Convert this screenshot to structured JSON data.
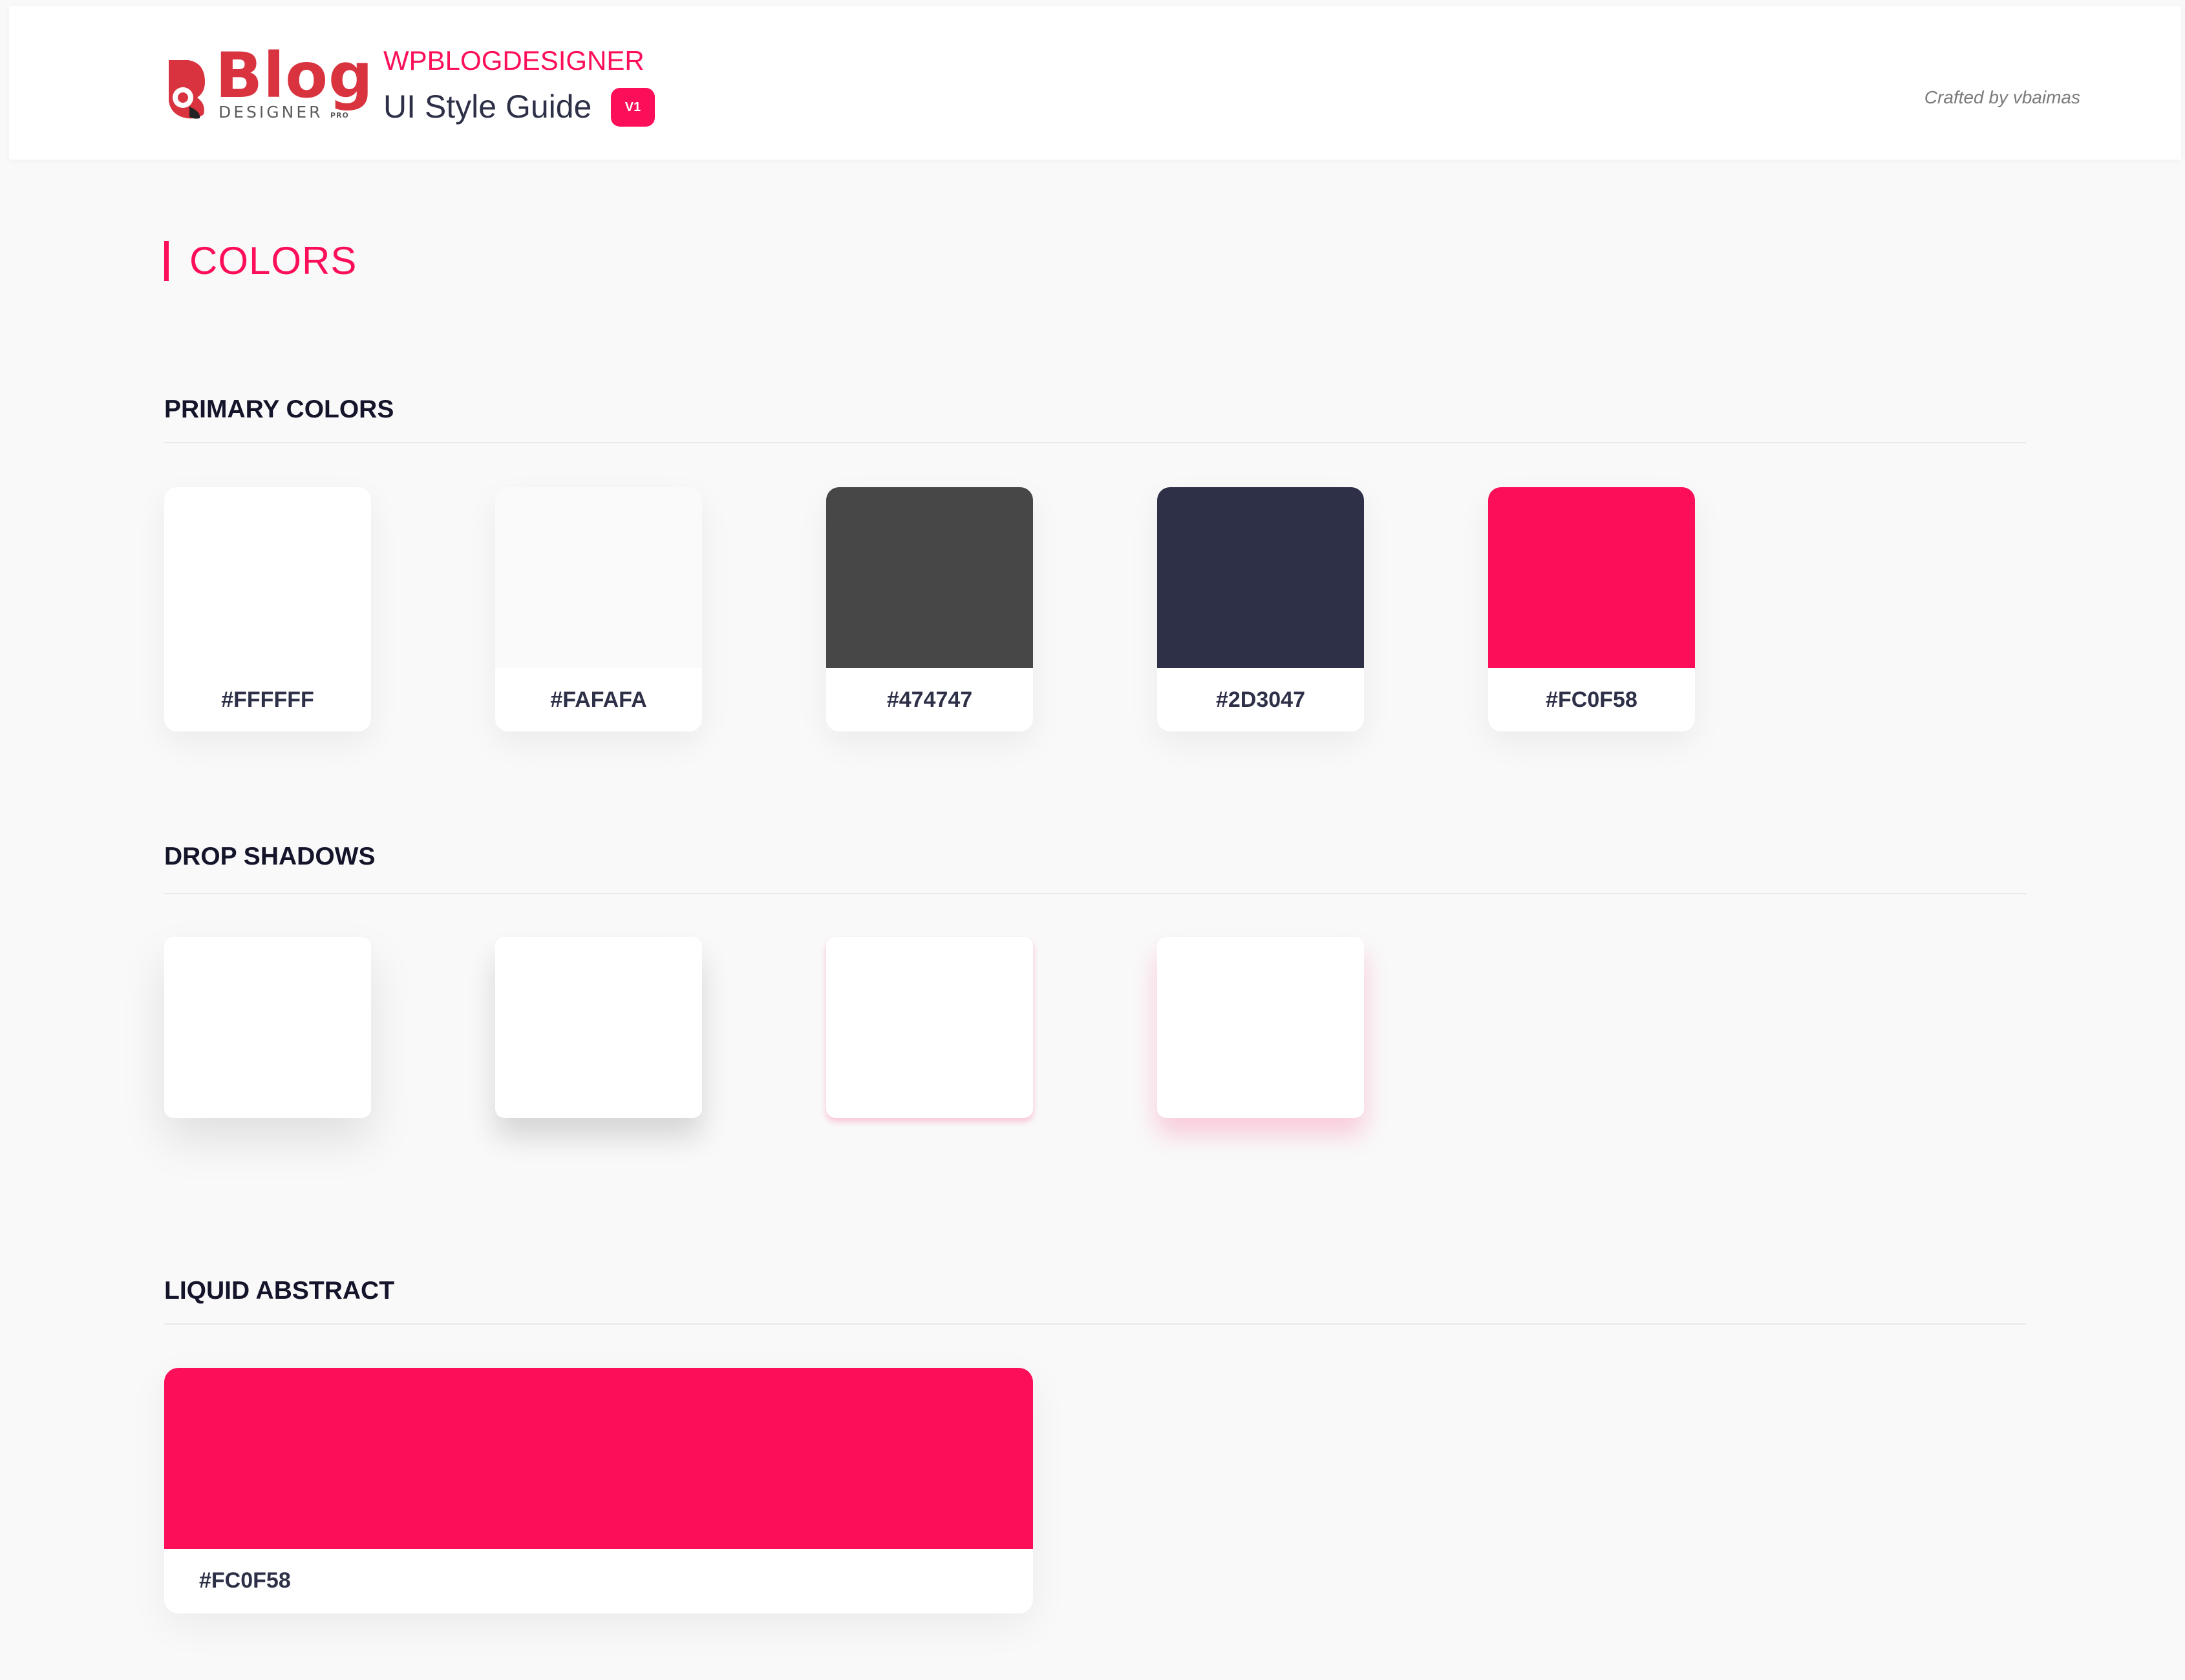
{
  "header": {
    "logo": {
      "word": "Blog",
      "sub": "DESIGNER",
      "pro": "PRO",
      "accent_color": "#d8333f"
    },
    "brand_name": "WPBLOGDESIGNER",
    "title": "UI Style Guide",
    "version": "V1",
    "credit": "Crafted by vbaimas"
  },
  "main": {
    "heading": "COLORS",
    "primary": {
      "title": "PRIMARY COLORS",
      "swatches": [
        {
          "hex": "#FFFFFF",
          "color": "#ffffff"
        },
        {
          "hex": "#FAFAFA",
          "color": "#fafafa"
        },
        {
          "hex": "#474747",
          "color": "#474747"
        },
        {
          "hex": "#2D3047",
          "color": "#2d3047"
        },
        {
          "hex": "#FC0F58",
          "color": "#fc0f58"
        }
      ]
    },
    "shadows": {
      "title": "DROP SHADOWS"
    },
    "liquid": {
      "title": "LIQUID ABSTRACT",
      "hex": "#FC0F58",
      "color": "#fc0f58"
    }
  }
}
